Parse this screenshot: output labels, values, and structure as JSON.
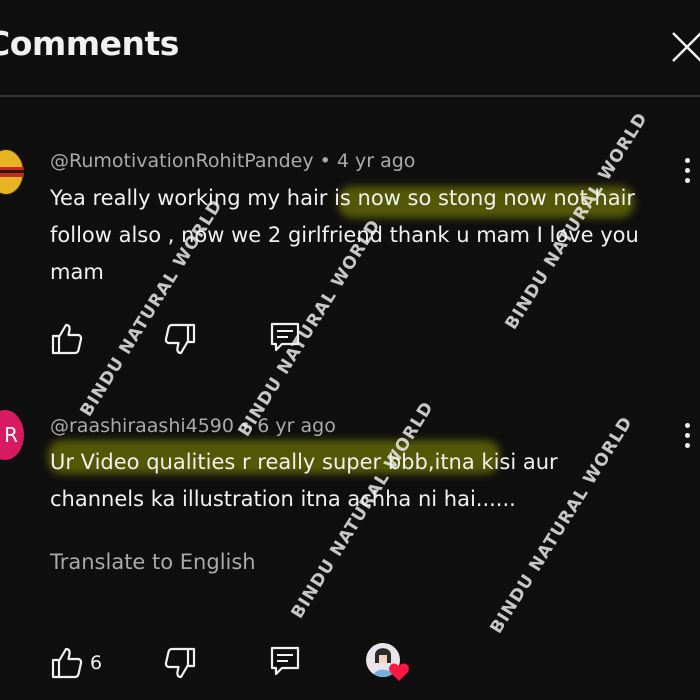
{
  "header": {
    "title": "Comments"
  },
  "comments": [
    {
      "author": "@RumotivationRohitPandey",
      "age": "• 4 yr ago",
      "lines": [
        "Yea really working my hair is now so stong now not hair",
        "follow also , now we 2 girlfriend thank u mam I love you",
        "mam"
      ]
    },
    {
      "author": "@raashiraashi4590",
      "age": "• 6 yr ago",
      "avatar_letter": "R",
      "lines": [
        "Ur Video qualities r really super bbb,itna kisi aur",
        "channels ka illustration itna achha ni hai......"
      ],
      "translate": "Translate to English",
      "like_count": "6"
    }
  ],
  "watermark": "BINDU NATURAL WORLD",
  "colors": {
    "background": "#0f0f0f",
    "highlight": "#8c9600",
    "avatar_r": "#d81b60"
  }
}
